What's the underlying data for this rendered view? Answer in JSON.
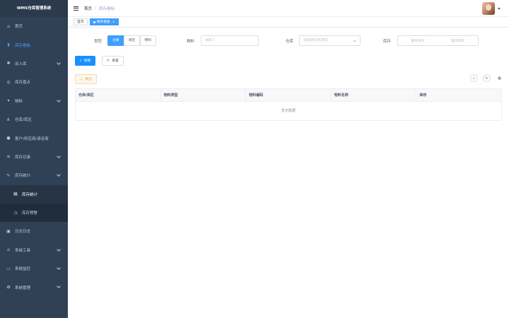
{
  "app": {
    "title": "WMS仓库管理系统"
  },
  "sidebar": {
    "items": [
      {
        "label": "首页",
        "icon": "home-icon",
        "active": false,
        "arrow": false
      },
      {
        "label": "库存看板",
        "icon": "chart-icon",
        "active": true,
        "arrow": false
      },
      {
        "label": "出入库",
        "icon": "gear-icon",
        "active": false,
        "arrow": true
      },
      {
        "label": "库存盘点",
        "icon": "circle-icon",
        "active": false,
        "arrow": false
      },
      {
        "label": "物料",
        "icon": "cart-icon",
        "active": false,
        "arrow": true
      },
      {
        "label": "仓库/库区",
        "icon": "tree-icon",
        "active": false,
        "arrow": false
      },
      {
        "label": "客户/供应商/承运商",
        "icon": "user-icon",
        "active": false,
        "arrow": false
      },
      {
        "label": "库存记录",
        "icon": "list-icon",
        "active": false,
        "arrow": true
      },
      {
        "label": "库存统计",
        "icon": "edit-icon",
        "active": false,
        "arrow": true
      }
    ],
    "submenu": [
      {
        "label": "库存统计",
        "icon": "doc-icon",
        "active": true
      },
      {
        "label": "库存预警",
        "icon": "clock-icon",
        "active": false
      }
    ],
    "items2": [
      {
        "label": "日志日志",
        "icon": "log-icon",
        "arrow": false
      },
      {
        "label": "系统工具",
        "icon": "tool-icon",
        "arrow": true
      },
      {
        "label": "系统监控",
        "icon": "monitor-icon",
        "arrow": true
      },
      {
        "label": "系统管理",
        "icon": "settings-icon",
        "arrow": true
      }
    ]
  },
  "header": {
    "breadcrumb": {
      "home": "首页",
      "current": "库存看板"
    }
  },
  "tags": [
    {
      "label": "首页",
      "active": false
    },
    {
      "label": "库存看板",
      "active": true
    }
  ],
  "filters": {
    "type_label": "类型",
    "type_options": [
      "仓库",
      "库区",
      "物料"
    ],
    "material_label": "物料",
    "material_placeholder": "请输入",
    "warehouse_label": "仓库",
    "warehouse_placeholder": "请选择仓库/库区",
    "stock_label": "库存",
    "stock_min_placeholder": "最低库存",
    "stock_max_placeholder": "最高库存"
  },
  "buttons": {
    "search": "搜索",
    "reset": "重置",
    "export": "导出"
  },
  "table": {
    "columns": [
      "仓库/库区",
      "物料类型",
      "物料编码",
      "物料名称",
      "库存"
    ],
    "empty_text": "暂无数据"
  },
  "colors": {
    "sidebar_bg": "#304156",
    "primary": "#1890ff",
    "menu_active": "#409eff"
  }
}
